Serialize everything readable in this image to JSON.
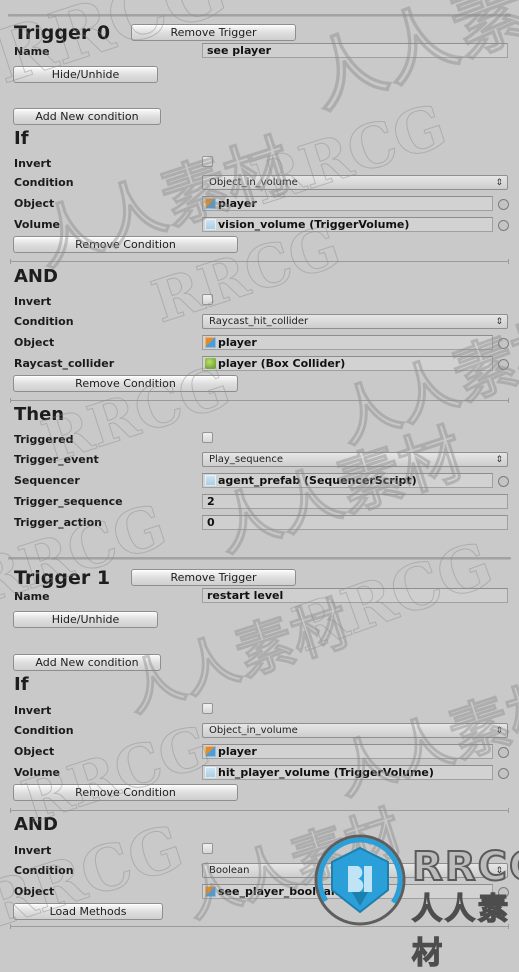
{
  "theme": {
    "background": "#c9c9c9",
    "field_bg": "#cfcfcf",
    "button_gradient_top": "#fbfbfb",
    "button_gradient_bottom": "#cfcfcf",
    "text": "#1b1b1b",
    "border": "#8e8e8e"
  },
  "watermark": {
    "logo_text": "RRCG",
    "logo_subtext": "人人素材",
    "tiles": [
      "RRCG",
      "人人素材"
    ]
  },
  "triggers": [
    {
      "title": "Trigger 0",
      "remove_label": "Remove Trigger",
      "name_label": "Name",
      "name_value": "see player",
      "hide_label": "Hide/Unhide",
      "add_condition_label": "Add New condition",
      "blocks": [
        {
          "heading": "If",
          "invert_label": "Invert",
          "invert_checked": false,
          "condition_label": "Condition",
          "condition_value": "Object_in_volume",
          "rows": [
            {
              "label": "Object",
              "value": "player",
              "icon": "prefab-icon"
            },
            {
              "label": "Volume",
              "value": "vision_volume (TriggerVolume)",
              "icon": "script-icon"
            }
          ],
          "remove_label": "Remove Condition"
        },
        {
          "heading": "AND",
          "invert_label": "Invert",
          "invert_checked": false,
          "condition_label": "Condition",
          "condition_value": "Raycast_hit_collider",
          "rows": [
            {
              "label": "Object",
              "value": "player",
              "icon": "prefab-icon"
            },
            {
              "label": "Raycast_collider",
              "value": "player (Box Collider)",
              "icon": "collider-icon"
            }
          ],
          "remove_label": "Remove Condition"
        }
      ],
      "then": {
        "heading": "Then",
        "triggered_label": "Triggered",
        "triggered_checked": false,
        "event_label": "Trigger_event",
        "event_value": "Play_sequence",
        "sequencer_label": "Sequencer",
        "sequencer_value": "agent_prefab (SequencerScript)",
        "sequencer_icon": "script-icon",
        "sequence_label": "Trigger_sequence",
        "sequence_value": "2",
        "action_label": "Trigger_action",
        "action_value": "0"
      }
    },
    {
      "title": "Trigger 1",
      "remove_label": "Remove Trigger",
      "name_label": "Name",
      "name_value": "restart level",
      "hide_label": "Hide/Unhide",
      "add_condition_label": "Add New condition",
      "blocks": [
        {
          "heading": "If",
          "invert_label": "Invert",
          "invert_checked": false,
          "condition_label": "Condition",
          "condition_value": "Object_in_volume",
          "rows": [
            {
              "label": "Object",
              "value": "player",
              "icon": "prefab-icon"
            },
            {
              "label": "Volume",
              "value": "hit_player_volume (TriggerVolume)",
              "icon": "script-icon"
            }
          ],
          "remove_label": "Remove Condition"
        },
        {
          "heading": "AND",
          "invert_label": "Invert",
          "invert_checked": false,
          "condition_label": "Condition",
          "condition_value": "Boolean",
          "rows": [
            {
              "label": "Object",
              "value": "see_player_boolean",
              "icon": "prefab-icon"
            }
          ],
          "load_methods_label": "Load Methods"
        }
      ]
    }
  ]
}
